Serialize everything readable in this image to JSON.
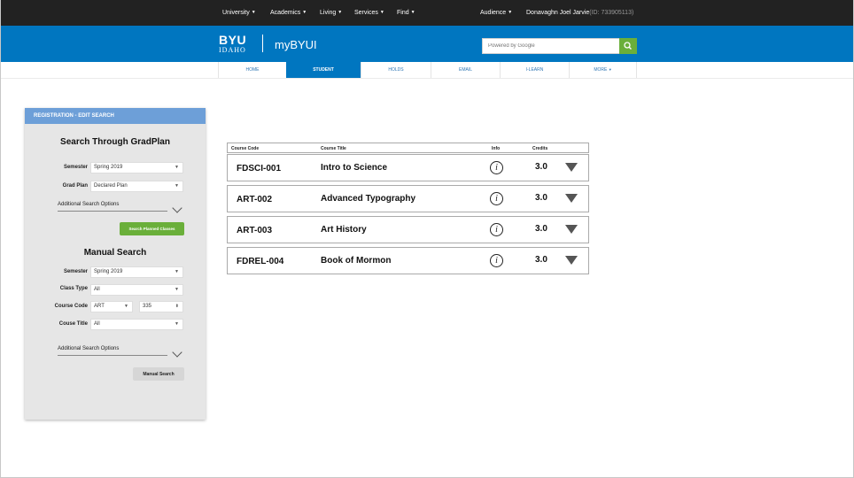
{
  "topbar": {
    "links": [
      "University",
      "Academics",
      "Living",
      "Services",
      "Find"
    ],
    "audience": "Audience",
    "user_name": "Donavaghn Joel Jarvie",
    "user_id": "(ID: 733905113)"
  },
  "header": {
    "logo_top": "BYU",
    "logo_bottom": "IDAHO",
    "site_name": "myBYUI",
    "search_placeholder": "Powered by Google",
    "search_icon": "search-icon"
  },
  "nav": {
    "tabs": [
      "HOME",
      "STUDENT",
      "HOLDS",
      "EMAIL",
      "I-LEARN",
      "MORE"
    ],
    "active": "STUDENT"
  },
  "panel": {
    "header": "REGISTRATION - EDIT SEARCH",
    "gradplan": {
      "title": "Search Through GradPlan",
      "semester_label": "Semester",
      "semester_value": "Spring 2019",
      "gradplan_label": "Grad Plan",
      "gradplan_value": "Declared Plan",
      "additional_options": "Additional Search Options",
      "search_button": "Search Planned Classes"
    },
    "manual": {
      "title": "Manual Search",
      "semester_label": "Semester",
      "semester_value": "Spring 2019",
      "class_type_label": "Class Type",
      "class_type_value": "All",
      "course_code_label": "Course Code",
      "course_code_subject": "ART",
      "course_code_number": "335",
      "course_title_label": "Couse Title",
      "course_title_value": "All",
      "additional_options": "Additional Search Options",
      "search_button": "Manual Search"
    }
  },
  "results": {
    "columns": [
      "Course Code",
      "Course Title",
      "Info",
      "Credits"
    ],
    "rows": [
      {
        "code": "FDSCI-001",
        "title": "Intro to Science",
        "info": "i",
        "credits": "3.0"
      },
      {
        "code": "ART-002",
        "title": "Advanced Typography",
        "info": "i",
        "credits": "3.0"
      },
      {
        "code": "ART-003",
        "title": "Art History",
        "info": "i",
        "credits": "3.0"
      },
      {
        "code": "FDREL-004",
        "title": "Book of Mormon",
        "info": "i",
        "credits": "3.0"
      }
    ]
  },
  "colors": {
    "topbar": "#222222",
    "brand_blue": "#0076c0",
    "panel_header": "#6d9fd8",
    "green": "#6aaf3a"
  }
}
